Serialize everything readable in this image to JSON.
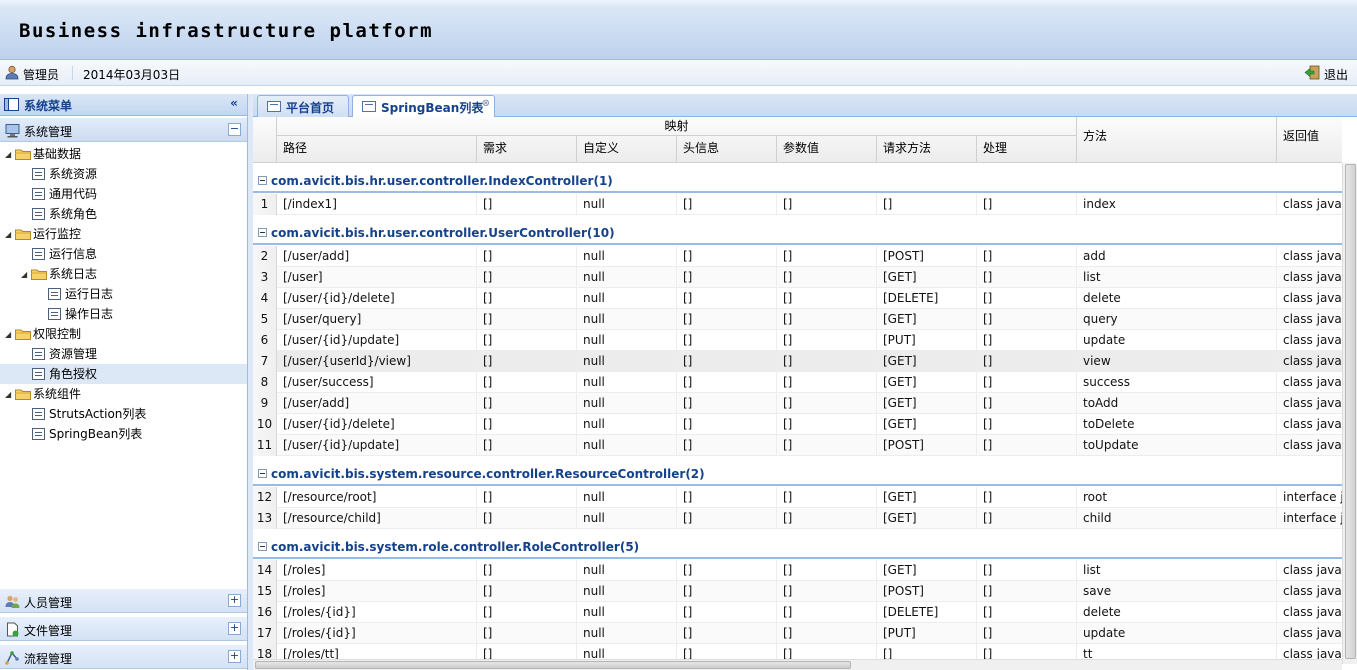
{
  "app": {
    "title": "Business infrastructure platform"
  },
  "userbar": {
    "user": "管理员",
    "date": "2014年03月03日",
    "logout": "退出"
  },
  "west": {
    "title": "系统菜单",
    "active_section": "系统管理",
    "tree": [
      {
        "label": "基础数据",
        "type": "folder"
      },
      {
        "label": "系统资源",
        "type": "leaf"
      },
      {
        "label": "通用代码",
        "type": "leaf"
      },
      {
        "label": "系统角色",
        "type": "leaf"
      },
      {
        "label": "运行监控",
        "type": "folder"
      },
      {
        "label": "运行信息",
        "type": "leaf"
      },
      {
        "label": "系统日志",
        "type": "folder"
      },
      {
        "label": "运行日志",
        "type": "leaf"
      },
      {
        "label": "操作日志",
        "type": "leaf"
      },
      {
        "label": "权限控制",
        "type": "folder"
      },
      {
        "label": "资源管理",
        "type": "leaf"
      },
      {
        "label": "角色授权",
        "type": "leaf",
        "selected": true
      },
      {
        "label": "系统组件",
        "type": "folder"
      },
      {
        "label": "StrutsAction列表",
        "type": "leaf"
      },
      {
        "label": "SpringBean列表",
        "type": "leaf"
      }
    ],
    "sections": [
      "人员管理",
      "文件管理",
      "流程管理"
    ]
  },
  "tabs": [
    {
      "label": "平台首页",
      "active": false
    },
    {
      "label": "SpringBean列表",
      "active": true,
      "closable": true
    }
  ],
  "grid": {
    "group_header": "映射",
    "columns": [
      "路径",
      "需求",
      "自定义",
      "头信息",
      "参数值",
      "请求方法",
      "处理",
      "方法",
      "返回值"
    ],
    "groups": [
      {
        "title": "com.avicit.bis.hr.user.controller.IndexController(1)",
        "rows": [
          {
            "n": "1",
            "path": "[/index1]",
            "req": "[]",
            "custom": "null",
            "headers": "[]",
            "params": "[]",
            "method": "[]",
            "handler": "[]",
            "func": "index",
            "ret": "class java.la"
          }
        ]
      },
      {
        "title": "com.avicit.bis.hr.user.controller.UserController(10)",
        "rows": [
          {
            "n": "2",
            "path": "[/user/add]",
            "req": "[]",
            "custom": "null",
            "headers": "[]",
            "params": "[]",
            "method": "[POST]",
            "handler": "[]",
            "func": "add",
            "ret": "class java.la"
          },
          {
            "n": "3",
            "path": "[/user]",
            "req": "[]",
            "custom": "null",
            "headers": "[]",
            "params": "[]",
            "method": "[GET]",
            "handler": "[]",
            "func": "list",
            "ret": "class java.la"
          },
          {
            "n": "4",
            "path": "[/user/{id}/delete]",
            "req": "[]",
            "custom": "null",
            "headers": "[]",
            "params": "[]",
            "method": "[DELETE]",
            "handler": "[]",
            "func": "delete",
            "ret": "class java.la"
          },
          {
            "n": "5",
            "path": "[/user/query]",
            "req": "[]",
            "custom": "null",
            "headers": "[]",
            "params": "[]",
            "method": "[GET]",
            "handler": "[]",
            "func": "query",
            "ret": "class java.la"
          },
          {
            "n": "6",
            "path": "[/user/{id}/update]",
            "req": "[]",
            "custom": "null",
            "headers": "[]",
            "params": "[]",
            "method": "[PUT]",
            "handler": "[]",
            "func": "update",
            "ret": "class java.la"
          },
          {
            "n": "7",
            "path": "[/user/{userId}/view]",
            "req": "[]",
            "custom": "null",
            "headers": "[]",
            "params": "[]",
            "method": "[GET]",
            "handler": "[]",
            "func": "view",
            "ret": "class java.la",
            "hl": true
          },
          {
            "n": "8",
            "path": "[/user/success]",
            "req": "[]",
            "custom": "null",
            "headers": "[]",
            "params": "[]",
            "method": "[GET]",
            "handler": "[]",
            "func": "success",
            "ret": "class java.la"
          },
          {
            "n": "9",
            "path": "[/user/add]",
            "req": "[]",
            "custom": "null",
            "headers": "[]",
            "params": "[]",
            "method": "[GET]",
            "handler": "[]",
            "func": "toAdd",
            "ret": "class java.la"
          },
          {
            "n": "10",
            "path": "[/user/{id}/delete]",
            "req": "[]",
            "custom": "null",
            "headers": "[]",
            "params": "[]",
            "method": "[GET]",
            "handler": "[]",
            "func": "toDelete",
            "ret": "class java.la"
          },
          {
            "n": "11",
            "path": "[/user/{id}/update]",
            "req": "[]",
            "custom": "null",
            "headers": "[]",
            "params": "[]",
            "method": "[POST]",
            "handler": "[]",
            "func": "toUpdate",
            "ret": "class java.la"
          }
        ]
      },
      {
        "title": "com.avicit.bis.system.resource.controller.ResourceController(2)",
        "rows": [
          {
            "n": "12",
            "path": "[/resource/root]",
            "req": "[]",
            "custom": "null",
            "headers": "[]",
            "params": "[]",
            "method": "[GET]",
            "handler": "[]",
            "func": "root",
            "ret": "interface ja"
          },
          {
            "n": "13",
            "path": "[/resource/child]",
            "req": "[]",
            "custom": "null",
            "headers": "[]",
            "params": "[]",
            "method": "[GET]",
            "handler": "[]",
            "func": "child",
            "ret": "interface ja"
          }
        ]
      },
      {
        "title": "com.avicit.bis.system.role.controller.RoleController(5)",
        "rows": [
          {
            "n": "14",
            "path": "[/roles]",
            "req": "[]",
            "custom": "null",
            "headers": "[]",
            "params": "[]",
            "method": "[GET]",
            "handler": "[]",
            "func": "list",
            "ret": "class java.la"
          },
          {
            "n": "15",
            "path": "[/roles]",
            "req": "[]",
            "custom": "null",
            "headers": "[]",
            "params": "[]",
            "method": "[POST]",
            "handler": "[]",
            "func": "save",
            "ret": "class java.la"
          },
          {
            "n": "16",
            "path": "[/roles/{id}]",
            "req": "[]",
            "custom": "null",
            "headers": "[]",
            "params": "[]",
            "method": "[DELETE]",
            "handler": "[]",
            "func": "delete",
            "ret": "class java.la"
          },
          {
            "n": "17",
            "path": "[/roles/{id}]",
            "req": "[]",
            "custom": "null",
            "headers": "[]",
            "params": "[]",
            "method": "[PUT]",
            "handler": "[]",
            "func": "update",
            "ret": "class java.la"
          },
          {
            "n": "18",
            "path": "[/roles/tt]",
            "req": "[]",
            "custom": "null",
            "headers": "[]",
            "params": "[]",
            "method": "[]",
            "handler": "[]",
            "func": "tt",
            "ret": "class java.la"
          }
        ]
      }
    ]
  },
  "icons": {
    "user": "user-icon",
    "logout": "exit-door-icon",
    "menu": "menu-panel-icon",
    "system": "computer-icon",
    "folder": "folder-icon",
    "leaf": "document-list-icon",
    "tab": "window-icon",
    "people": "people-icon",
    "file": "file-icon",
    "flow": "flow-icon"
  },
  "colors": {
    "header": "#bdd2ee",
    "title_text": "#15428b",
    "border": "#99bbe8",
    "selection": "#dde8f6"
  }
}
